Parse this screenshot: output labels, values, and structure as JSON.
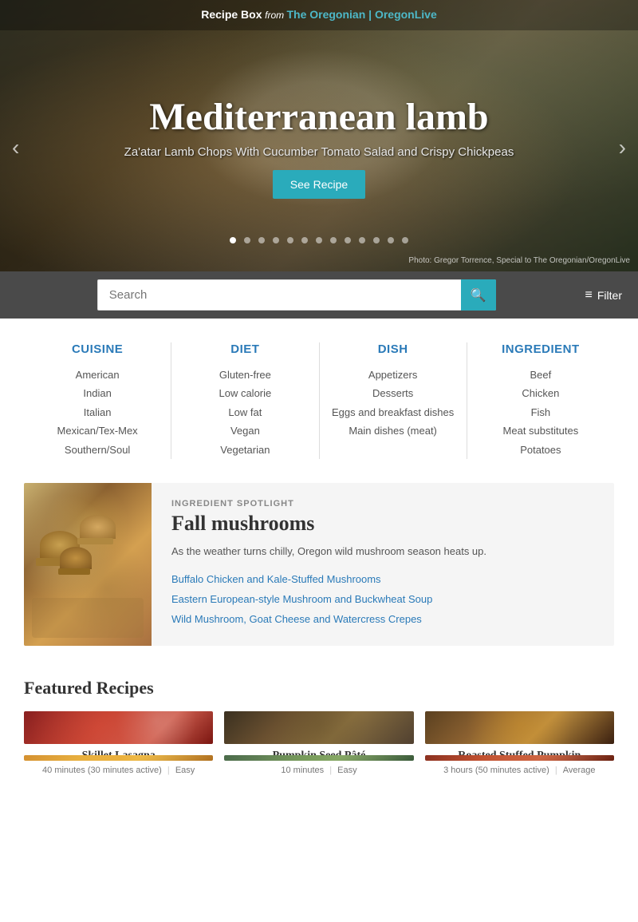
{
  "hero": {
    "brand": {
      "prefix": "Recipe Box",
      "from": " from ",
      "name": "The Oregonian | OregonLive"
    },
    "title": "Mediterranean lamb",
    "subtitle": "Za'atar Lamb Chops With Cucumber Tomato Salad and Crispy Chickpeas",
    "cta_label": "See Recipe",
    "photo_credit": "Photo: Gregor Torrence, Special to The Oregonian/OregonLive",
    "dots": [
      1,
      2,
      3,
      4,
      5,
      6,
      7,
      8,
      9,
      10,
      11,
      12,
      13
    ],
    "active_dot": 0,
    "prev_label": "‹",
    "next_label": "›"
  },
  "search": {
    "placeholder": "Search",
    "filter_label": "Filter"
  },
  "categories": [
    {
      "header": "CUISINE",
      "items": [
        "American",
        "Indian",
        "Italian",
        "Mexican/Tex-Mex",
        "Southern/Soul"
      ]
    },
    {
      "header": "DIET",
      "items": [
        "Gluten-free",
        "Low calorie",
        "Low fat",
        "Vegan",
        "Vegetarian"
      ]
    },
    {
      "header": "DISH",
      "items": [
        "Appetizers",
        "Desserts",
        "Eggs and breakfast dishes",
        "Main dishes (meat)"
      ]
    },
    {
      "header": "INGREDIENT",
      "items": [
        "Beef",
        "Chicken",
        "Fish",
        "Meat substitutes",
        "Potatoes"
      ]
    }
  ],
  "spotlight": {
    "label": "INGREDIENT SPOTLIGHT",
    "title": "Fall mushrooms",
    "description": "As the weather turns chilly, Oregon wild mushroom season heats up.",
    "links": [
      "Buffalo Chicken and Kale-Stuffed Mushrooms",
      "Eastern European-style Mushroom and Buckwheat Soup",
      "Wild Mushroom, Goat Cheese and Watercress Crepes"
    ]
  },
  "featured": {
    "section_title": "Featured Recipes",
    "recipes": [
      {
        "name": "Skillet Lasagna",
        "time": "40 minutes (30 minutes active)",
        "difficulty": "Easy",
        "img_class": "recipe-img-1"
      },
      {
        "name": "Pumpkin Seed Pâté",
        "time": "10 minutes",
        "difficulty": "Easy",
        "img_class": "recipe-img-2"
      },
      {
        "name": "Roasted Stuffed Pumpkin",
        "time": "3 hours (50 minutes active)",
        "difficulty": "Average",
        "img_class": "recipe-img-3"
      },
      {
        "name": "",
        "time": "",
        "difficulty": "",
        "img_class": "recipe-img-4"
      },
      {
        "name": "",
        "time": "",
        "difficulty": "",
        "img_class": "recipe-img-5"
      },
      {
        "name": "",
        "time": "",
        "difficulty": "",
        "img_class": "recipe-img-6"
      }
    ]
  },
  "icons": {
    "search": "🔍",
    "filter": "≡",
    "prev": "❮",
    "next": "❯"
  }
}
